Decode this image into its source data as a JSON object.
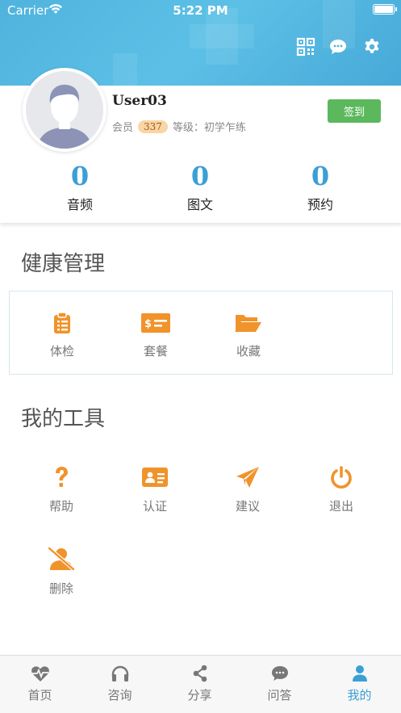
{
  "status_bar": {
    "carrier": "Carrier",
    "time": "5:22 PM"
  },
  "header": {
    "icons": [
      "qr-code-icon",
      "chat-icon",
      "gear-icon"
    ],
    "background_color": "#52b6e0"
  },
  "profile": {
    "username": "User03",
    "member_label": "会员",
    "member_points": "337",
    "level_text": "等级：初学乍练",
    "checkin_label": "签到"
  },
  "stats": [
    {
      "value": "0",
      "label": "音频"
    },
    {
      "value": "0",
      "label": "图文"
    },
    {
      "value": "0",
      "label": "预约"
    }
  ],
  "health": {
    "title": "健康管理",
    "items": [
      {
        "label": "体检",
        "icon": "clipboard-icon"
      },
      {
        "label": "套餐",
        "icon": "ticket-icon"
      },
      {
        "label": "收藏",
        "icon": "folder-open-icon"
      }
    ]
  },
  "tools": {
    "title": "我的工具",
    "items": [
      {
        "label": "帮助",
        "icon": "question-icon"
      },
      {
        "label": "认证",
        "icon": "id-card-icon"
      },
      {
        "label": "建议",
        "icon": "paper-plane-icon"
      },
      {
        "label": "退出",
        "icon": "power-icon"
      },
      {
        "label": "删除",
        "icon": "user-delete-icon"
      }
    ]
  },
  "tabbar": [
    {
      "label": "首页",
      "icon": "heartbeat-icon",
      "active": false
    },
    {
      "label": "咨询",
      "icon": "headphones-icon",
      "active": false
    },
    {
      "label": "分享",
      "icon": "share-icon",
      "active": false
    },
    {
      "label": "问答",
      "icon": "comments-icon",
      "active": false
    },
    {
      "label": "我的",
      "icon": "user-icon",
      "active": true
    }
  ],
  "colors": {
    "accent": "#3aa0d4",
    "icon_orange": "#f0932b",
    "checkin_green": "#5cb85c"
  }
}
